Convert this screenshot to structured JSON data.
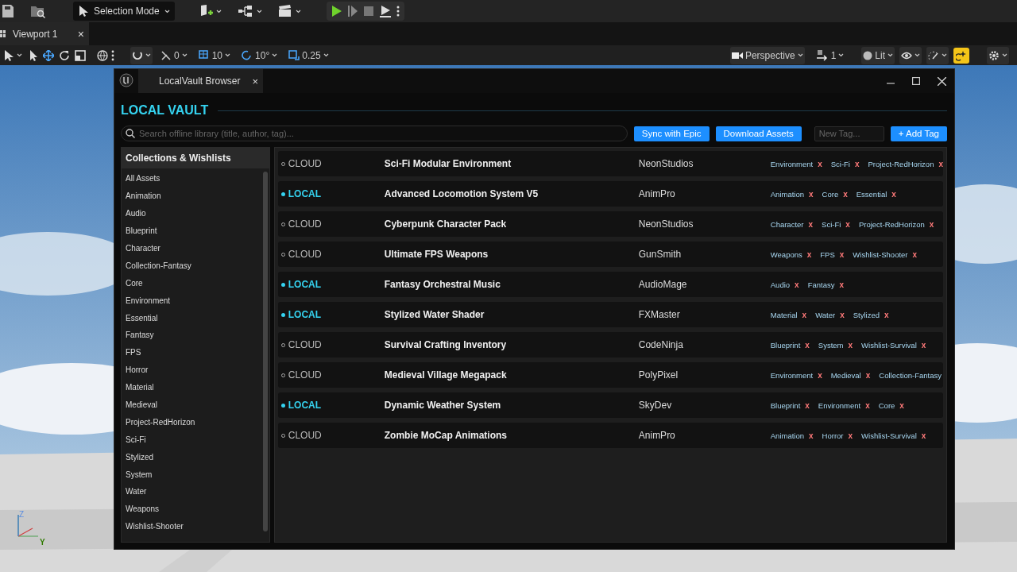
{
  "toolbar": {
    "mode": "Selection Mode"
  },
  "viewport_tab": {
    "label": "Viewport 1",
    "close": "×"
  },
  "viewport_toolbar": {
    "snap_values": [
      "0",
      "10",
      "10°",
      "0.25"
    ],
    "view": "Perspective",
    "camera_speed": "1",
    "view_mode": "Lit"
  },
  "axis_gizmo": {
    "labels": [
      "Z",
      "Y"
    ]
  },
  "window": {
    "title": "LocalVault Browser",
    "close_tab": "×"
  },
  "header": {
    "title": "LOCAL VAULT"
  },
  "search": {
    "placeholder": "Search offline library (title, author, tag)..."
  },
  "buttons": [
    "Sync with Epic",
    "Download Assets"
  ],
  "new_tag": {
    "placeholder": "New Tag..."
  },
  "add_tag": "+ Add Tag",
  "sidebar": {
    "title": "Collections & Wishlists",
    "items": [
      "All Assets",
      "Animation",
      "Audio",
      "Blueprint",
      "Character",
      "Collection-Fantasy",
      "Core",
      "Environment",
      "Essential",
      "Fantasy",
      "FPS",
      "Horror",
      "Material",
      "Medieval",
      "Project-RedHorizon",
      "Sci-Fi",
      "Stylized",
      "System",
      "Water",
      "Weapons",
      "Wishlist-Shooter"
    ]
  },
  "assets": [
    {
      "kind": "cloud",
      "status": "CLOUD",
      "title": "Sci-Fi Modular Environment",
      "author": "NeonStudios",
      "tags": [
        {
          "label": "Environment",
          "remove": "x"
        },
        {
          "label": "Sci-Fi",
          "remove": "x"
        },
        {
          "label": "Project-RedHorizon",
          "remove": "x"
        }
      ]
    },
    {
      "kind": "local",
      "status": "LOCAL",
      "title": "Advanced Locomotion System V5",
      "author": "AnimPro",
      "tags": [
        {
          "label": "Animation",
          "remove": "x"
        },
        {
          "label": "Core",
          "remove": "x"
        },
        {
          "label": "Essential",
          "remove": "x"
        }
      ]
    },
    {
      "kind": "cloud",
      "status": "CLOUD",
      "title": "Cyberpunk Character Pack",
      "author": "NeonStudios",
      "tags": [
        {
          "label": "Character",
          "remove": "x"
        },
        {
          "label": "Sci-Fi",
          "remove": "x"
        },
        {
          "label": "Project-RedHorizon",
          "remove": "x"
        }
      ]
    },
    {
      "kind": "cloud",
      "status": "CLOUD",
      "title": "Ultimate FPS Weapons",
      "author": "GunSmith",
      "tags": [
        {
          "label": "Weapons",
          "remove": "x"
        },
        {
          "label": "FPS",
          "remove": "x"
        },
        {
          "label": "Wishlist-Shooter",
          "remove": "x"
        }
      ]
    },
    {
      "kind": "local",
      "status": "LOCAL",
      "title": "Fantasy Orchestral Music",
      "author": "AudioMage",
      "tags": [
        {
          "label": "Audio",
          "remove": "x"
        },
        {
          "label": "Fantasy",
          "remove": "x"
        }
      ]
    },
    {
      "kind": "local",
      "status": "LOCAL",
      "title": "Stylized Water Shader",
      "author": "FXMaster",
      "tags": [
        {
          "label": "Material",
          "remove": "x"
        },
        {
          "label": "Water",
          "remove": "x"
        },
        {
          "label": "Stylized",
          "remove": "x"
        }
      ]
    },
    {
      "kind": "cloud",
      "status": "CLOUD",
      "title": "Survival Crafting Inventory",
      "author": "CodeNinja",
      "tags": [
        {
          "label": "Blueprint",
          "remove": "x"
        },
        {
          "label": "System",
          "remove": "x"
        },
        {
          "label": "Wishlist-Survival",
          "remove": "x"
        }
      ]
    },
    {
      "kind": "cloud",
      "status": "CLOUD",
      "title": "Medieval Village Megapack",
      "author": "PolyPixel",
      "tags": [
        {
          "label": "Environment",
          "remove": "x"
        },
        {
          "label": "Medieval",
          "remove": "x"
        },
        {
          "label": "Collection-Fantasy"
        }
      ]
    },
    {
      "kind": "local",
      "status": "LOCAL",
      "title": "Dynamic Weather System",
      "author": "SkyDev",
      "tags": [
        {
          "label": "Blueprint",
          "remove": "x"
        },
        {
          "label": "Environment",
          "remove": "x"
        },
        {
          "label": "Core",
          "remove": "x"
        }
      ]
    },
    {
      "kind": "cloud",
      "status": "CLOUD",
      "title": "Zombie MoCap Animations",
      "author": "AnimPro",
      "tags": [
        {
          "label": "Animation",
          "remove": "x"
        },
        {
          "label": "Horror",
          "remove": "x"
        },
        {
          "label": "Wishlist-Survival",
          "remove": "x"
        }
      ]
    }
  ]
}
